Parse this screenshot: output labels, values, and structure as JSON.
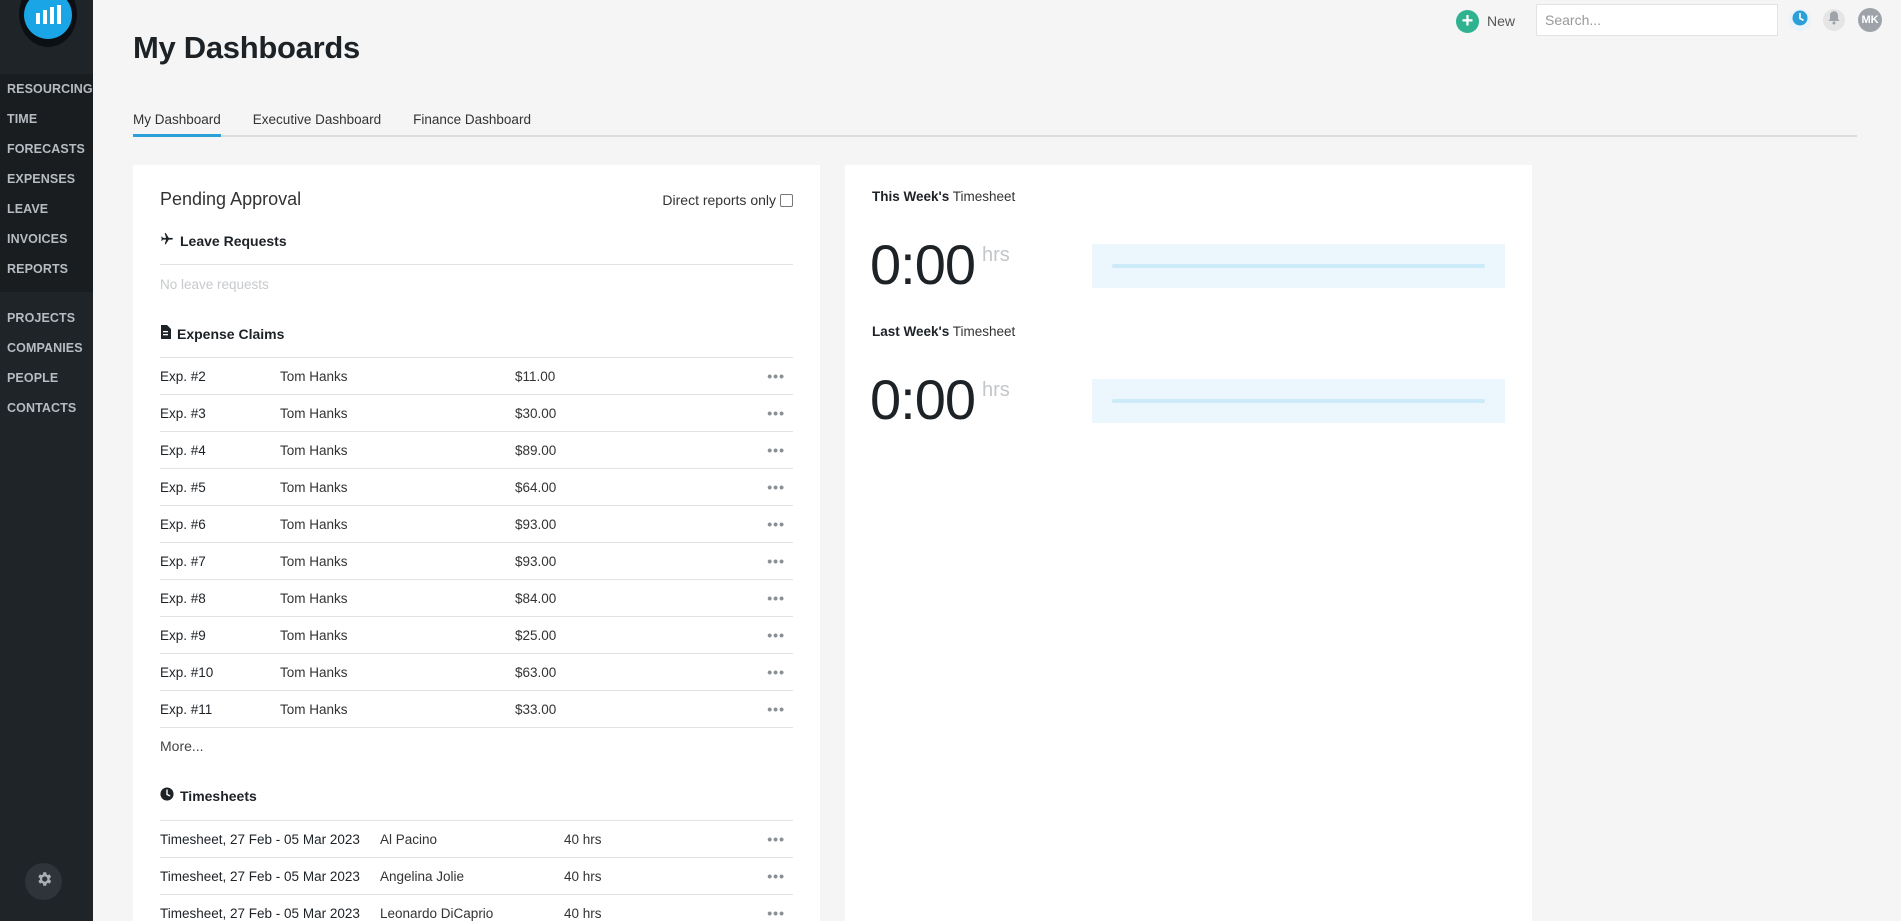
{
  "sidebar": {
    "primary": [
      {
        "label": "RESOURCING"
      },
      {
        "label": "TIME"
      },
      {
        "label": "FORECASTS"
      },
      {
        "label": "EXPENSES"
      },
      {
        "label": "LEAVE"
      },
      {
        "label": "INVOICES"
      },
      {
        "label": "REPORTS"
      }
    ],
    "secondary": [
      {
        "label": "PROJECTS"
      },
      {
        "label": "COMPANIES"
      },
      {
        "label": "PEOPLE"
      },
      {
        "label": "CONTACTS"
      }
    ]
  },
  "topbar": {
    "new_label": "New",
    "search_placeholder": "Search...",
    "avatar_initials": "MK"
  },
  "page": {
    "title": "My Dashboards",
    "tabs": [
      {
        "label": "My Dashboard",
        "active": true
      },
      {
        "label": "Executive Dashboard",
        "active": false
      },
      {
        "label": "Finance Dashboard",
        "active": false
      }
    ]
  },
  "pending": {
    "title": "Pending Approval",
    "direct_reports_label": "Direct reports only",
    "leave": {
      "heading": "Leave Requests",
      "empty_text": "No leave requests"
    },
    "expenses": {
      "heading": "Expense Claims",
      "rows": [
        {
          "id": "Exp. #2",
          "person": "Tom Hanks",
          "amount": "$11.00"
        },
        {
          "id": "Exp. #3",
          "person": "Tom Hanks",
          "amount": "$30.00"
        },
        {
          "id": "Exp. #4",
          "person": "Tom Hanks",
          "amount": "$89.00"
        },
        {
          "id": "Exp. #5",
          "person": "Tom Hanks",
          "amount": "$64.00"
        },
        {
          "id": "Exp. #6",
          "person": "Tom Hanks",
          "amount": "$93.00"
        },
        {
          "id": "Exp. #7",
          "person": "Tom Hanks",
          "amount": "$93.00"
        },
        {
          "id": "Exp. #8",
          "person": "Tom Hanks",
          "amount": "$84.00"
        },
        {
          "id": "Exp. #9",
          "person": "Tom Hanks",
          "amount": "$25.00"
        },
        {
          "id": "Exp. #10",
          "person": "Tom Hanks",
          "amount": "$63.00"
        },
        {
          "id": "Exp. #11",
          "person": "Tom Hanks",
          "amount": "$33.00"
        }
      ],
      "more_label": "More..."
    },
    "timesheets": {
      "heading": "Timesheets",
      "rows": [
        {
          "period": "Timesheet, 27 Feb - 05 Mar 2023",
          "person": "Al Pacino",
          "hours": "40 hrs"
        },
        {
          "period": "Timesheet, 27 Feb - 05 Mar 2023",
          "person": "Angelina Jolie",
          "hours": "40 hrs"
        },
        {
          "period": "Timesheet, 27 Feb - 05 Mar 2023",
          "person": "Leonardo DiCaprio",
          "hours": "40 hrs"
        }
      ]
    }
  },
  "timesheet_widget": {
    "this_week": {
      "label_bold": "This Week's",
      "label_rest": "Timesheet",
      "value": "0:00",
      "unit": "hrs",
      "progress": 0
    },
    "last_week": {
      "label_bold": "Last Week's",
      "label_rest": "Timesheet",
      "value": "0:00",
      "unit": "hrs",
      "progress": 0
    }
  },
  "colors": {
    "accent": "#2a9fd8",
    "new_button": "#2eb28f",
    "sidebar": "#1f2428"
  }
}
